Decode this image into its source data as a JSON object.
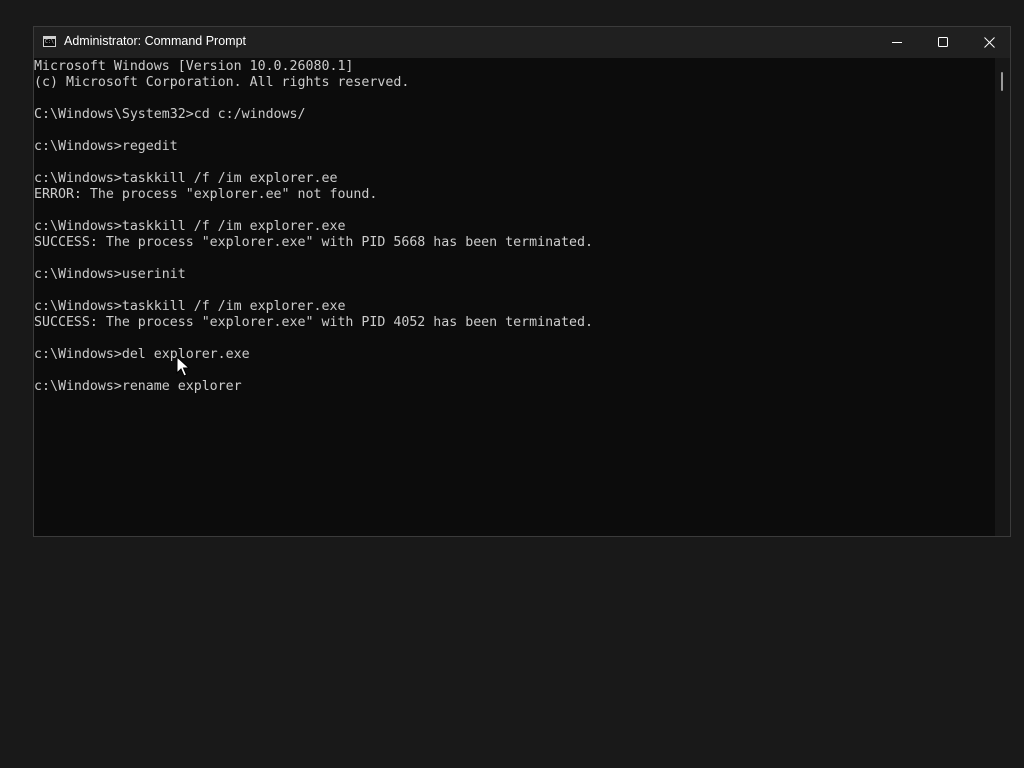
{
  "window": {
    "title": "Administrator: Command Prompt",
    "icon": "command-prompt-icon",
    "controls": {
      "minimize": "minimize-icon",
      "maximize": "maximize-icon",
      "close": "close-icon"
    }
  },
  "console": {
    "lines": [
      "Microsoft Windows [Version 10.0.26080.1]",
      "(c) Microsoft Corporation. All rights reserved.",
      "",
      "C:\\Windows\\System32>cd c:/windows/",
      "",
      "c:\\Windows>regedit",
      "",
      "c:\\Windows>taskkill /f /im explorer.ee",
      "ERROR: The process \"explorer.ee\" not found.",
      "",
      "c:\\Windows>taskkill /f /im explorer.exe",
      "SUCCESS: The process \"explorer.exe\" with PID 5668 has been terminated.",
      "",
      "c:\\Windows>userinit",
      "",
      "c:\\Windows>taskkill /f /im explorer.exe",
      "SUCCESS: The process \"explorer.exe\" with PID 4052 has been terminated.",
      "",
      "c:\\Windows>del explorer.exe",
      "",
      "c:\\Windows>rename explorer"
    ]
  },
  "colors": {
    "desktop": "#191919",
    "titlebar": "#202020",
    "console_bg": "#0c0c0c",
    "console_text": "#cccccc"
  }
}
